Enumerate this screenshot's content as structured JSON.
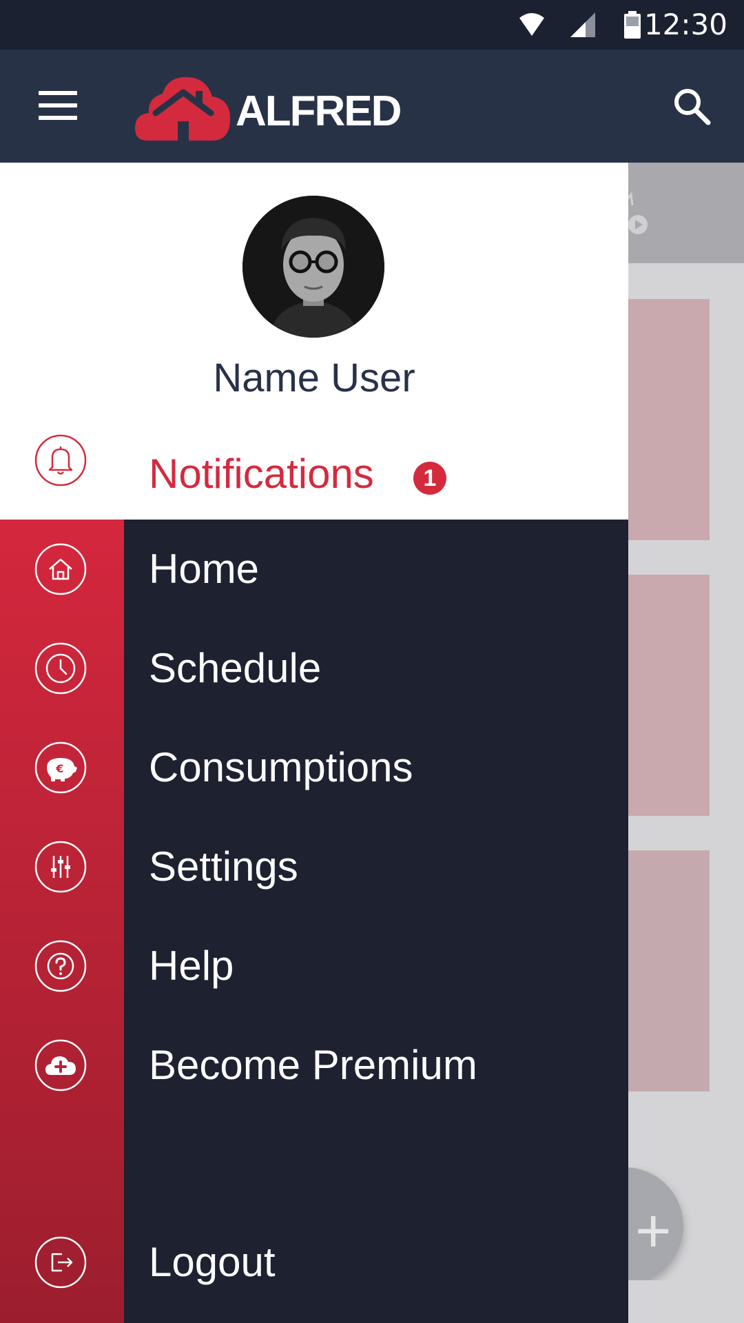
{
  "status_bar": {
    "time": "12:30"
  },
  "app_bar": {
    "brand": "ALFRED"
  },
  "drawer": {
    "user_name": "Name User",
    "notifications": {
      "label": "Notifications",
      "badge": "1"
    },
    "items": [
      {
        "label": "Home",
        "icon": "home-icon"
      },
      {
        "label": "Schedule",
        "icon": "clock-icon"
      },
      {
        "label": "Consumptions",
        "icon": "piggy-bank-icon"
      },
      {
        "label": "Settings",
        "icon": "sliders-icon"
      },
      {
        "label": "Help",
        "icon": "help-icon"
      },
      {
        "label": "Become Premium",
        "icon": "cloud-plus-icon"
      }
    ],
    "logout": {
      "label": "Logout",
      "icon": "logout-icon"
    }
  },
  "colors": {
    "accent": "#d42a3e",
    "app_bar": "#283247",
    "drawer_dark": "#1d2130",
    "status_bar": "#1b2130"
  }
}
